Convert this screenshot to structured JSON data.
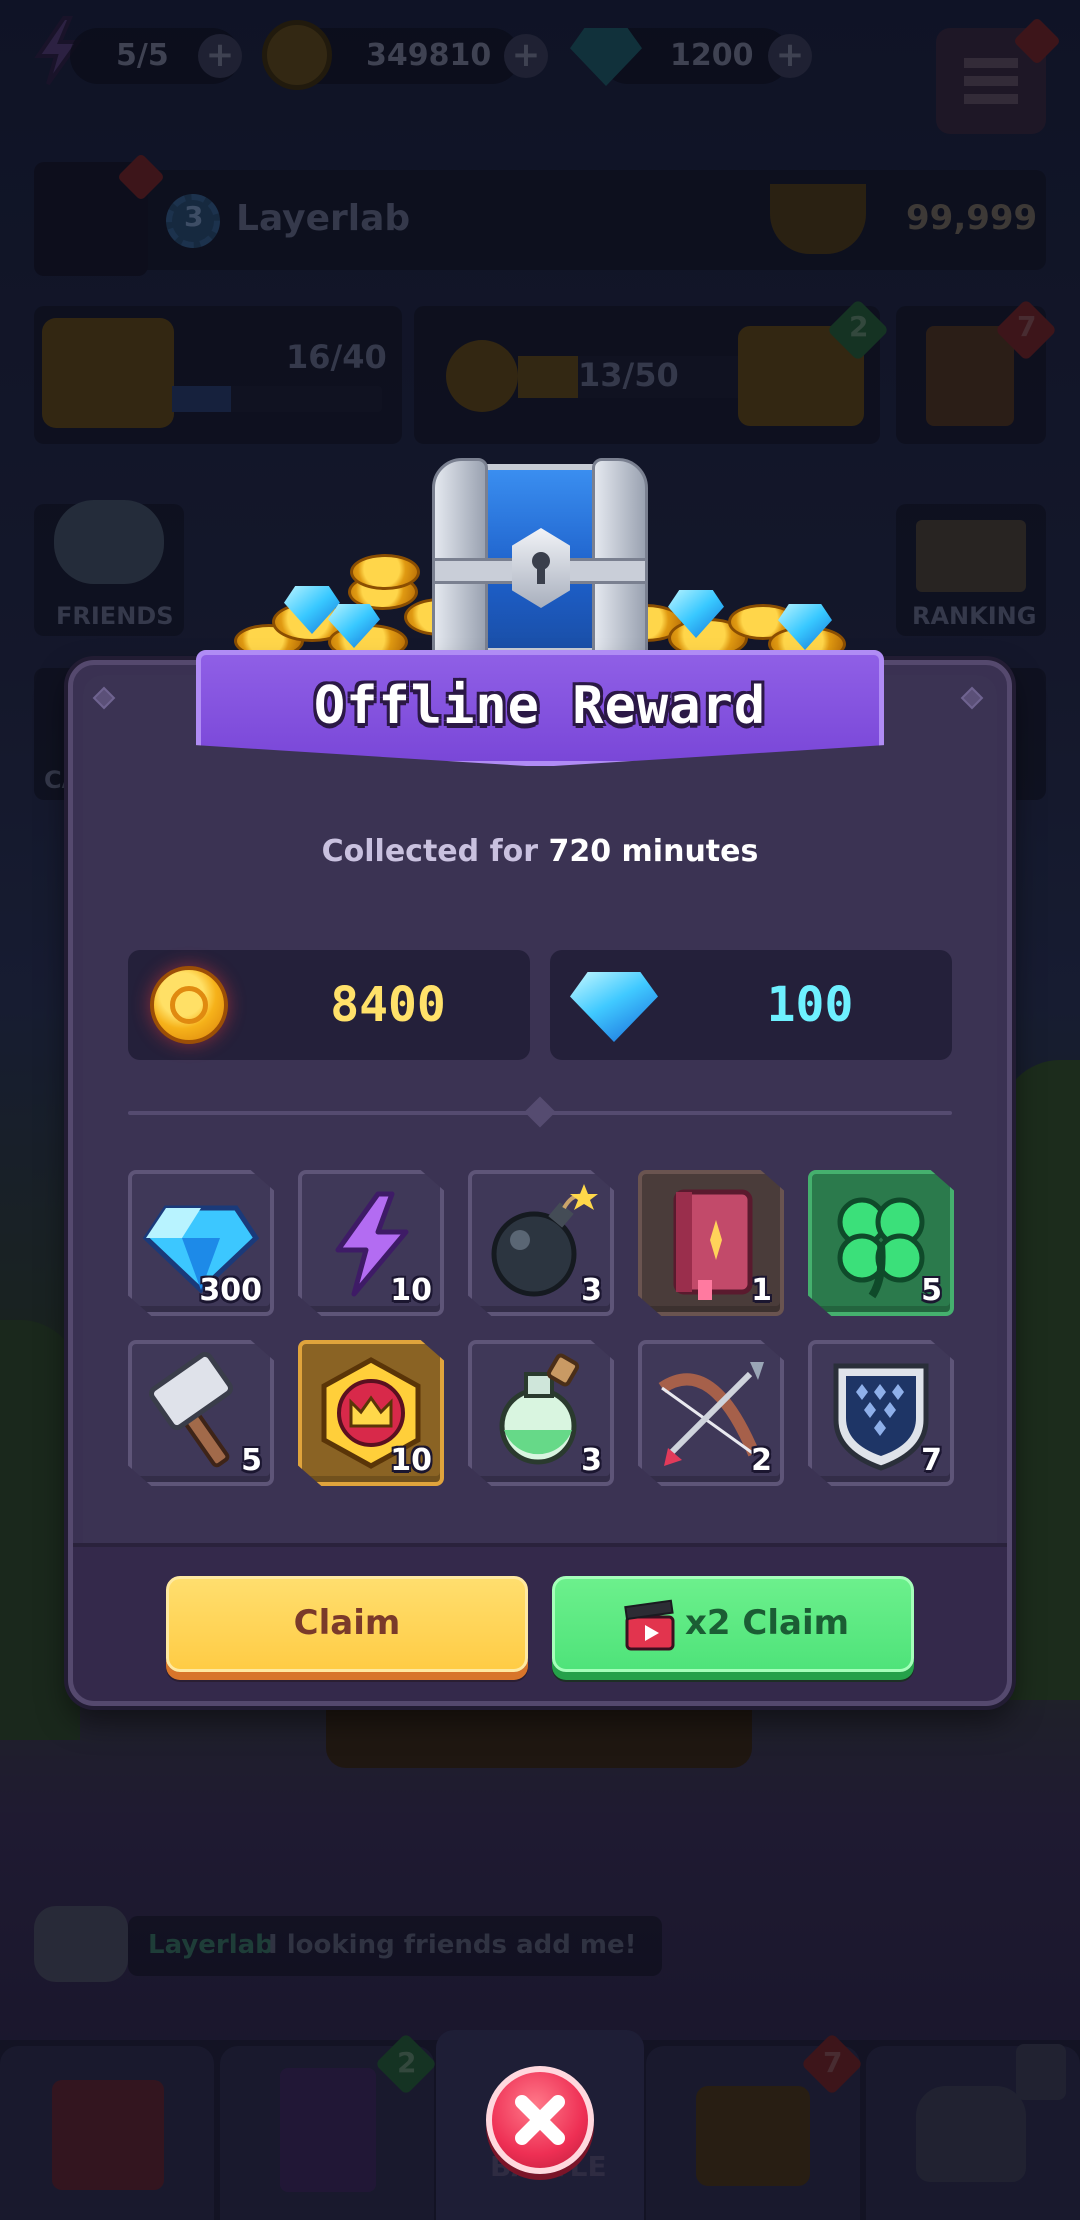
{
  "hud": {
    "energy": "5/5",
    "coins": "349810",
    "gems": "1200",
    "player_level": "3",
    "player_name": "Layerlab",
    "trophies": "99,999",
    "chest_progress": "16/40",
    "pass_progress": "13/50",
    "pass_badge": "2",
    "quest_badge": "7",
    "friends_label": "FRIENDS",
    "ranking_label": "RANKING",
    "side_left_label": "CA"
  },
  "chat": {
    "sender": "Layerlab",
    "message": "I looking friends add me!"
  },
  "bottom_nav": {
    "battle_label": "BATTLE",
    "book_badge": "2",
    "chest_badge": "7"
  },
  "modal": {
    "title": "Offline Reward",
    "collected_prefix": "Collected for",
    "collected_value": "720 minutes",
    "coin_amount": "8400",
    "gem_amount": "100",
    "items": [
      {
        "icon": "gem-icon",
        "qty": "300",
        "frame": "default"
      },
      {
        "icon": "lightning-icon",
        "qty": "10",
        "frame": "default"
      },
      {
        "icon": "bomb-icon",
        "qty": "3",
        "frame": "default"
      },
      {
        "icon": "spellbook-icon",
        "qty": "1",
        "frame": "brown"
      },
      {
        "icon": "clover-icon",
        "qty": "5",
        "frame": "green"
      },
      {
        "icon": "hammer-icon",
        "qty": "5",
        "frame": "default"
      },
      {
        "icon": "crown-badge-icon",
        "qty": "10",
        "frame": "gold"
      },
      {
        "icon": "potion-icon",
        "qty": "3",
        "frame": "default"
      },
      {
        "icon": "bow-icon",
        "qty": "2",
        "frame": "default"
      },
      {
        "icon": "shield-icon",
        "qty": "7",
        "frame": "default"
      }
    ],
    "claim_label": "Claim",
    "x2_claim_label": "x2 Claim"
  },
  "colors": {
    "coin_text": "#ffe16a",
    "gem_text": "#6ef0ff",
    "banner": "#7a47d8",
    "claim_button": "#ffcf4a",
    "x2_button": "#54e67e"
  }
}
